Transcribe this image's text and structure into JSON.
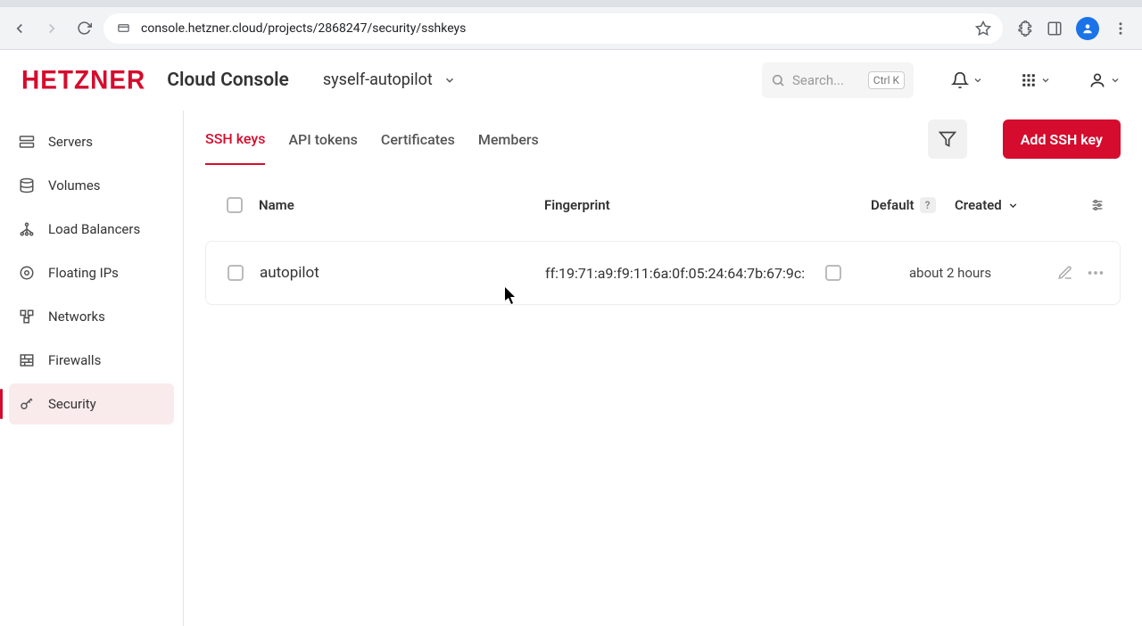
{
  "browser": {
    "url": "console.hetzner.cloud/projects/2868247/security/sshkeys"
  },
  "header": {
    "logo": "HETZNER",
    "console": "Cloud Console",
    "project": "syself-autopilot",
    "search_placeholder": "Search...",
    "search_kbd": "Ctrl K"
  },
  "sidebar": {
    "items": [
      {
        "label": "Servers"
      },
      {
        "label": "Volumes"
      },
      {
        "label": "Load Balancers"
      },
      {
        "label": "Floating IPs"
      },
      {
        "label": "Networks"
      },
      {
        "label": "Firewalls"
      },
      {
        "label": "Security"
      }
    ]
  },
  "tabs": {
    "items": [
      {
        "label": "SSH keys"
      },
      {
        "label": "API tokens"
      },
      {
        "label": "Certificates"
      },
      {
        "label": "Members"
      }
    ],
    "add_button": "Add SSH key"
  },
  "table": {
    "columns": {
      "name": "Name",
      "fingerprint": "Fingerprint",
      "default": "Default",
      "created": "Created"
    },
    "rows": [
      {
        "name": "autopilot",
        "fingerprint": "ff:19:71:a9:f9:11:6a:0f:05:24:64:7b:67:9c:",
        "default": false,
        "created": "about 2 hours"
      }
    ]
  }
}
